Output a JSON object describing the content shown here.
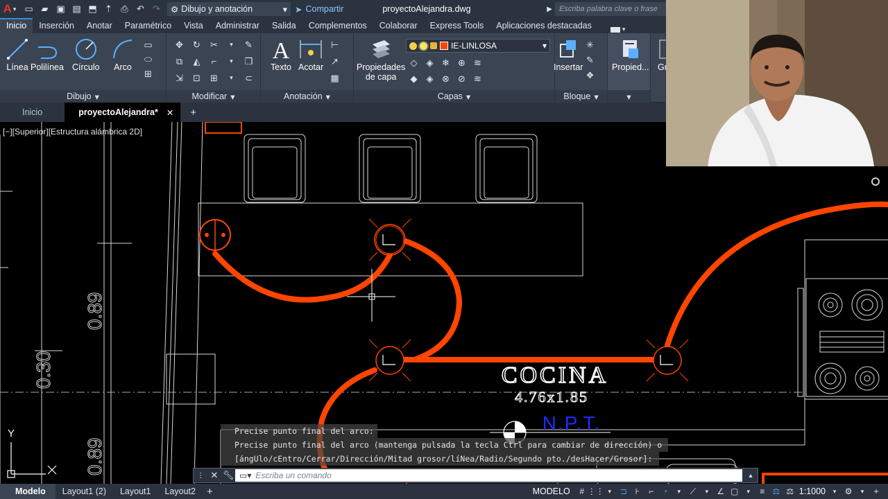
{
  "titlebar": {
    "workspace": "Dibujo y anotación",
    "share": "Compartir",
    "doc_title": "proyectoAlejandra.dwg",
    "search_placeholder": "Escriba palabra clave o frase"
  },
  "ribbon_tabs": [
    "Inicio",
    "Inserción",
    "Anotar",
    "Paramétrico",
    "Vista",
    "Administrar",
    "Salida",
    "Complementos",
    "Colaborar",
    "Express Tools",
    "Aplicaciones destacadas"
  ],
  "ribbon": {
    "draw_tools": [
      "Línea",
      "Polilínea",
      "Círculo",
      "Arco"
    ],
    "draw_panel": "Dibujo",
    "modify_panel": "Modificar",
    "annot_tools": [
      "Texto",
      "Acotar"
    ],
    "annot_panel": "Anotación",
    "layer_props_1": "Propiedades",
    "layer_props_2": "de capa",
    "layer_name": "IE-LINLOSA",
    "layer_panel": "Capas",
    "insert_label": "Insertar",
    "block_panel": "Bloque",
    "props_label": "Propied...",
    "groups_label": "Gr"
  },
  "file_tabs": {
    "home": "Inicio",
    "active": "proyectoAlejandra*"
  },
  "viewport_label": "[−][Superior][Estructura alámbrica 2D]",
  "drawing": {
    "room_name": "COCINA",
    "room_size": "4.76x1.85",
    "npt": "N.P.T."
  },
  "command": {
    "history": [
      "Precise punto final del arco:",
      "Precise punto final del arco (mantenga pulsada la tecla Ctrl para cambiar de dirección) o",
      "[ángUlo/cEntro/Cerrar/Dirección/Mitad grosor/líNea/Radio/Segundo pto./desHacer/Grosor]:"
    ],
    "placeholder": "Escriba un comando"
  },
  "status": {
    "tabs": [
      "Modelo",
      "Layout1 (2)",
      "Layout1",
      "Layout2"
    ],
    "mode": "MODELO",
    "scale": "1:1000"
  },
  "colors": {
    "accent": "#3b8fd9",
    "electric_lines": "#ff4500",
    "ribbon_bg": "#3b4453",
    "bar_bg": "#2b3340"
  }
}
